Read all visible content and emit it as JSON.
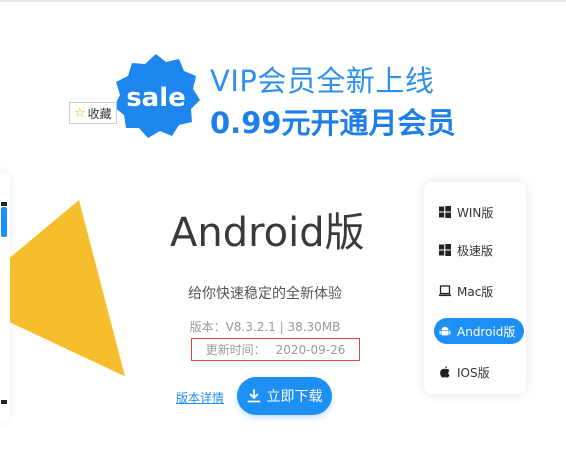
{
  "promo": {
    "badge_text": "sale",
    "line1": "VIP会员全新上线",
    "line2": "0.99元开通月会员"
  },
  "favorites": {
    "label": "收藏"
  },
  "app": {
    "title": "Android版",
    "tagline": "给你快速稳定的全新体验",
    "version": "版本：V8.3.2.1 | 38.30MB",
    "update_label": "更新时间：",
    "update_date": "2020-09-26",
    "details_link": "版本详情",
    "download_label": "立即下载"
  },
  "platforms": [
    {
      "label": "WIN版",
      "icon": "windows-icon",
      "active": false
    },
    {
      "label": "极速版",
      "icon": "windows-icon",
      "active": false
    },
    {
      "label": "Mac版",
      "icon": "laptop-icon",
      "active": false
    },
    {
      "label": "Android版",
      "icon": "android-icon",
      "active": true
    },
    {
      "label": "IOS版",
      "icon": "apple-icon",
      "active": false
    }
  ],
  "colors": {
    "accent": "#1e8ff5",
    "promo_text": "#2f8ff0",
    "triangle": "#f6be2c",
    "highlight_border": "#d94848"
  }
}
